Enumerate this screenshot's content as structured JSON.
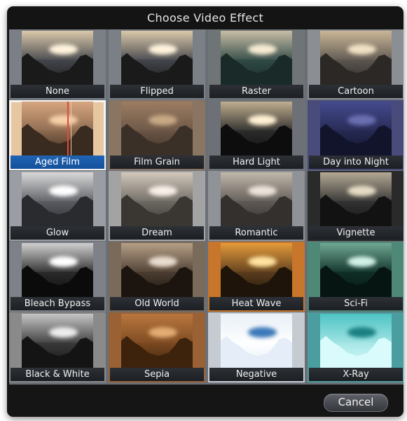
{
  "dialog": {
    "title": "Choose Video Effect",
    "cancel_label": "Cancel"
  },
  "effects": [
    {
      "label": "None",
      "selected": false,
      "sky": "#d9c8aa",
      "cloud": "#fff3dc",
      "land": "#43464c",
      "cliff": "#1a1a1a",
      "side": "#7b7f86"
    },
    {
      "label": "Flipped",
      "selected": false,
      "sky": "#d9c8aa",
      "cloud": "#fff3dc",
      "land": "#43464c",
      "cliff": "#1a1a1a",
      "side": "#7b7f86"
    },
    {
      "label": "Raster",
      "selected": false,
      "sky": "#c8bda6",
      "cloud": "#f5ead2",
      "land": "#2f4a45",
      "cliff": "#1a2a28",
      "side": "#6f7476"
    },
    {
      "label": "Cartoon",
      "selected": false,
      "sky": "#c9b696",
      "cloud": "#f0e0c4",
      "land": "#5c5650",
      "cliff": "#2b2825",
      "side": "#8b8f94"
    },
    {
      "label": "Aged Film",
      "selected": true,
      "sky": "#d7a680",
      "cloud": "#f4cfa8",
      "land": "#8c6a4f",
      "cliff": "#3a2b20",
      "side": "#e7c7a2"
    },
    {
      "label": "Film Grain",
      "selected": false,
      "sky": "#9d7d62",
      "cloud": "#c8a986",
      "land": "#6b5646",
      "cliff": "#3b3028",
      "side": "#8a7563"
    },
    {
      "label": "Hard Light",
      "selected": false,
      "sky": "#bfae8f",
      "cloud": "#fff1d4",
      "land": "#2c2c2c",
      "cliff": "#0d0d0d",
      "side": "#6d7177"
    },
    {
      "label": "Day into Night",
      "selected": false,
      "sky": "#454a8e",
      "cloud": "#6a6fb1",
      "land": "#262a52",
      "cliff": "#11142b",
      "side": "#494c7b"
    },
    {
      "label": "Glow",
      "selected": false,
      "sky": "#d8d8d8",
      "cloud": "#ffffff",
      "land": "#5b5d63",
      "cliff": "#2a2b2f",
      "side": "#9a9ea4"
    },
    {
      "label": "Dream",
      "selected": false,
      "sky": "#d2c7bb",
      "cloud": "#f8f0e8",
      "land": "#6d6963",
      "cliff": "#3a3733",
      "side": "#a3a3a3"
    },
    {
      "label": "Romantic",
      "selected": false,
      "sky": "#c1b7ab",
      "cloud": "#ece3d9",
      "land": "#5f5a56",
      "cliff": "#33302d",
      "side": "#8f9398"
    },
    {
      "label": "Vignette",
      "selected": false,
      "sky": "#b3a893",
      "cloud": "#e6dbc4",
      "land": "#333333",
      "cliff": "#121212",
      "side": "#2a2a2a"
    },
    {
      "label": "Bleach Bypass",
      "selected": false,
      "sky": "#d0d0d0",
      "cloud": "#ffffff",
      "land": "#2b2b2b",
      "cliff": "#0b0b0b",
      "side": "#7e8288"
    },
    {
      "label": "Old World",
      "selected": false,
      "sky": "#b59f86",
      "cloud": "#e9ddd0",
      "land": "#4b3d31",
      "cliff": "#1c150f",
      "side": "#7a6a5a"
    },
    {
      "label": "Heat Wave",
      "selected": false,
      "sky": "#e49a3a",
      "cloud": "#ffe3a0",
      "land": "#5b3d1e",
      "cliff": "#1e1409",
      "side": "#c7762b"
    },
    {
      "label": "Sci-Fi",
      "selected": false,
      "sky": "#6fa792",
      "cloud": "#d3f2e7",
      "land": "#0f2f27",
      "cliff": "#061511",
      "side": "#4e8977"
    },
    {
      "label": "Black & White",
      "selected": false,
      "sky": "#c5c5c5",
      "cloud": "#ededed",
      "land": "#3a3a3a",
      "cliff": "#141414",
      "side": "#8a8a8a"
    },
    {
      "label": "Sepia",
      "selected": false,
      "sky": "#b9773f",
      "cloud": "#e2ac73",
      "land": "#7c4a21",
      "cliff": "#3d220c",
      "side": "#9a6135"
    },
    {
      "label": "Negative",
      "selected": false,
      "sky": "#e9f0f7",
      "cloud": "#3b78b9",
      "land": "#ffffff",
      "cliff": "#e5eef8",
      "side": "#c6cbd1"
    },
    {
      "label": "X-Ray",
      "selected": false,
      "sky": "#4fc3c4",
      "cloud": "#1a7f82",
      "land": "#a6e6e6",
      "cliff": "#d9fbfb",
      "side": "#4b9ea0"
    }
  ]
}
